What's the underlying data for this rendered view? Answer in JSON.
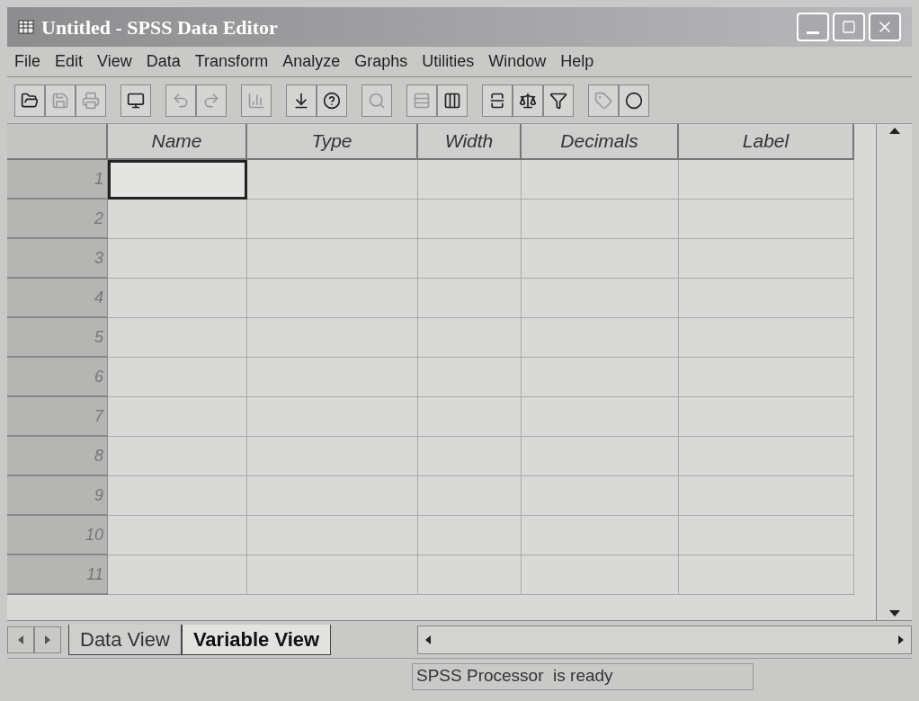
{
  "window": {
    "title": "Untitled - SPSS Data Editor"
  },
  "menu": [
    "File",
    "Edit",
    "View",
    "Data",
    "Transform",
    "Analyze",
    "Graphs",
    "Utilities",
    "Window",
    "Help"
  ],
  "toolbar": [
    {
      "kind": "open",
      "disabled": false
    },
    {
      "kind": "save",
      "disabled": true
    },
    {
      "kind": "print",
      "disabled": true
    },
    {
      "kind": "recall",
      "disabled": false
    },
    {
      "kind": "undo",
      "disabled": true
    },
    {
      "kind": "redo",
      "disabled": true
    },
    {
      "kind": "chart",
      "disabled": true
    },
    {
      "kind": "goto",
      "disabled": false
    },
    {
      "kind": "variables",
      "disabled": false
    },
    {
      "kind": "find",
      "disabled": true
    },
    {
      "kind": "insert-case",
      "disabled": true
    },
    {
      "kind": "insert-variable",
      "disabled": false
    },
    {
      "kind": "split",
      "disabled": false
    },
    {
      "kind": "weight",
      "disabled": false
    },
    {
      "kind": "select",
      "disabled": false
    },
    {
      "kind": "labels",
      "disabled": true
    },
    {
      "kind": "sets",
      "disabled": false
    }
  ],
  "table": {
    "columns": [
      "Name",
      "Type",
      "Width",
      "Decimals",
      "Label"
    ],
    "rows": [
      {
        "number": "1",
        "selected": true
      },
      {
        "number": "2",
        "selected": false
      },
      {
        "number": "3",
        "selected": false
      },
      {
        "number": "4",
        "selected": false
      },
      {
        "number": "5",
        "selected": false
      },
      {
        "number": "6",
        "selected": false
      },
      {
        "number": "7",
        "selected": false
      },
      {
        "number": "8",
        "selected": false
      },
      {
        "number": "9",
        "selected": false
      },
      {
        "number": "10",
        "selected": false
      },
      {
        "number": "11",
        "selected": false
      }
    ]
  },
  "sheet_tabs": [
    {
      "label": "Data View",
      "selected": false
    },
    {
      "label": "Variable View",
      "selected": true
    }
  ],
  "status_bar": {
    "message": "SPSS Processor  is ready"
  }
}
